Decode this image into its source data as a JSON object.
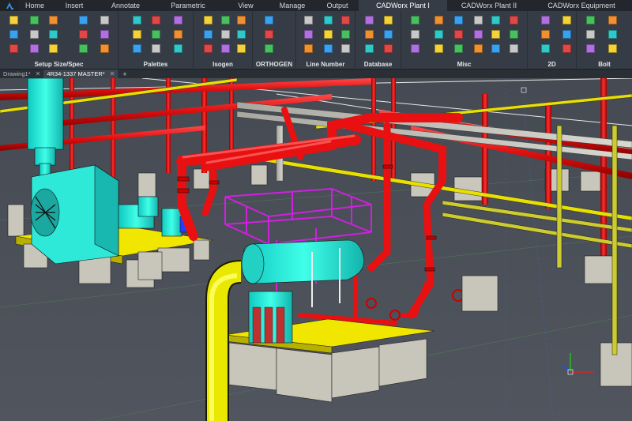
{
  "menubar": {
    "tabs": [
      {
        "label": "Home",
        "active": false
      },
      {
        "label": "Insert",
        "active": false
      },
      {
        "label": "Annotate",
        "active": false
      },
      {
        "label": "Parametric",
        "active": false
      },
      {
        "label": "View",
        "active": false
      },
      {
        "label": "Manage",
        "active": false
      },
      {
        "label": "Output",
        "active": false
      },
      {
        "label": "CADWorx Plant I",
        "active": true
      },
      {
        "label": "CADWorx Plant II",
        "active": false
      },
      {
        "label": "CADWorx Equipment",
        "active": false
      }
    ]
  },
  "ribbon": {
    "groups": [
      {
        "label": "Setup Size/Spec"
      },
      {
        "label": "Palettes"
      },
      {
        "label": "Isogen"
      },
      {
        "label": "ORTHOGEN"
      },
      {
        "label": "Line Number"
      },
      {
        "label": "Database"
      },
      {
        "label": "Misc"
      },
      {
        "label": "2D"
      },
      {
        "label": "Bolt"
      }
    ]
  },
  "doctabs": {
    "tabs": [
      {
        "label": "Drawing1*",
        "active": false
      },
      {
        "label": "4R34-1337 MASTER*",
        "active": true
      }
    ],
    "new_tab_label": "+"
  },
  "viewport": {
    "title": "3D model viewport"
  }
}
